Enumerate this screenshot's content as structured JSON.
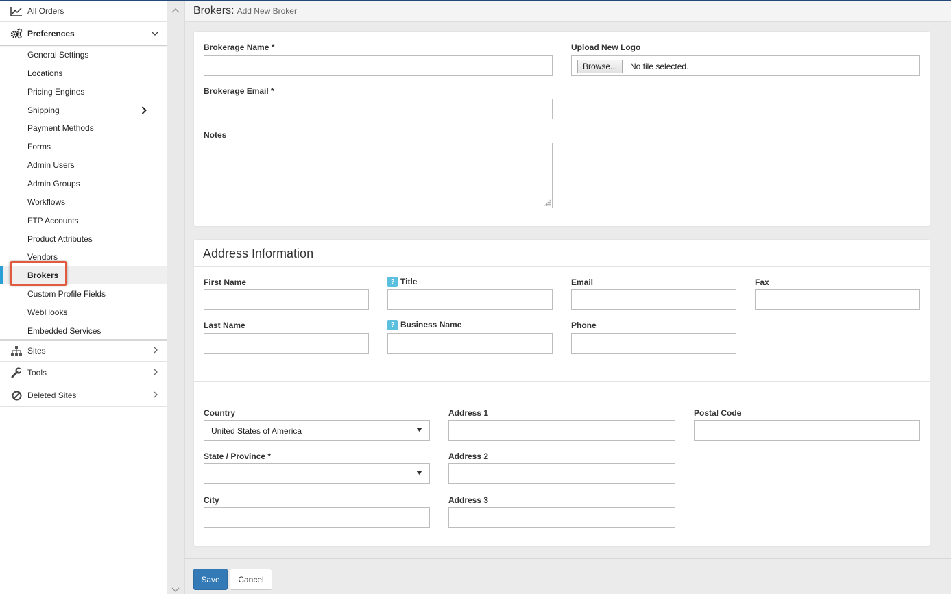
{
  "header": {
    "title": "Brokers:",
    "subtitle": "Add New Broker"
  },
  "sidebar": {
    "all_orders": "All Orders",
    "preferences": "Preferences",
    "preferences_items": [
      "General Settings",
      "Locations",
      "Pricing Engines",
      "Shipping",
      "Payment Methods",
      "Forms",
      "Admin Users",
      "Admin Groups",
      "Workflows",
      "FTP Accounts",
      "Product Attributes",
      "Vendors",
      "Brokers",
      "Custom Profile Fields",
      "WebHooks",
      "Embedded Services"
    ],
    "sites": "Sites",
    "tools": "Tools",
    "deleted_sites": "Deleted Sites"
  },
  "broker_form": {
    "brokerage_name_label": "Brokerage Name *",
    "brokerage_email_label": "Brokerage Email *",
    "notes_label": "Notes",
    "upload_logo_label": "Upload New Logo",
    "browse_label": "Browse...",
    "file_status": "No file selected."
  },
  "address": {
    "section_title": "Address Information",
    "first_name_label": "First Name",
    "title_label": "Title",
    "email_label": "Email",
    "fax_label": "Fax",
    "last_name_label": "Last Name",
    "business_name_label": "Business Name",
    "phone_label": "Phone",
    "help_glyph": "?",
    "country_label": "Country",
    "country_value": "United States of America",
    "state_label": "State / Province *",
    "state_value": "",
    "city_label": "City",
    "address1_label": "Address 1",
    "address2_label": "Address 2",
    "address3_label": "Address 3",
    "postal_code_label": "Postal Code"
  },
  "actions": {
    "save_label": "Save",
    "cancel_label": "Cancel"
  },
  "colors": {
    "accent": "#337ab7",
    "active_bar": "#2a9fd6",
    "highlight": "#e05a3f",
    "help": "#5bc0de"
  }
}
